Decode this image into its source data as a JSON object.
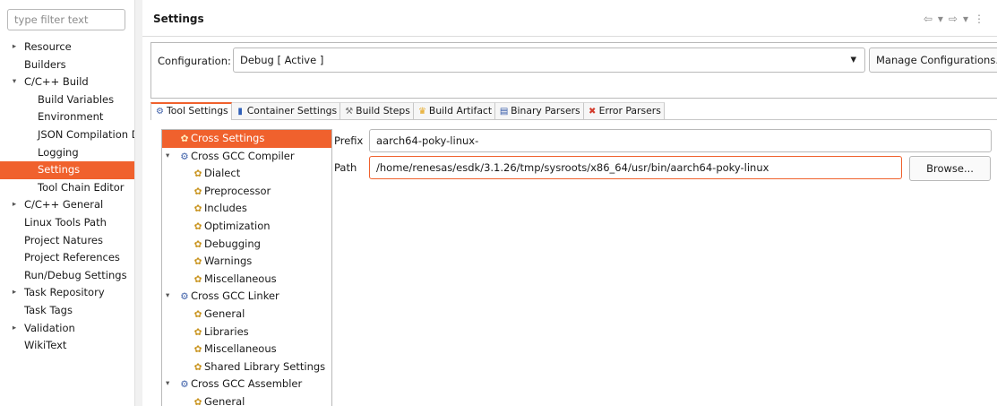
{
  "filter": {
    "placeholder": "type filter text"
  },
  "nav": {
    "items": [
      {
        "label": "Resource",
        "level": 0,
        "twisty": "▸"
      },
      {
        "label": "Builders",
        "level": 0,
        "twisty": ""
      },
      {
        "label": "C/C++ Build",
        "level": 0,
        "twisty": "▾"
      },
      {
        "label": "Build Variables",
        "level": 1,
        "twisty": ""
      },
      {
        "label": "Environment",
        "level": 1,
        "twisty": ""
      },
      {
        "label": "JSON Compilation D",
        "level": 1,
        "twisty": ""
      },
      {
        "label": "Logging",
        "level": 1,
        "twisty": ""
      },
      {
        "label": "Settings",
        "level": 1,
        "twisty": "",
        "selected": true
      },
      {
        "label": "Tool Chain Editor",
        "level": 1,
        "twisty": ""
      },
      {
        "label": "C/C++ General",
        "level": 0,
        "twisty": "▸"
      },
      {
        "label": "Linux Tools Path",
        "level": 0,
        "twisty": ""
      },
      {
        "label": "Project Natures",
        "level": 0,
        "twisty": ""
      },
      {
        "label": "Project References",
        "level": 0,
        "twisty": ""
      },
      {
        "label": "Run/Debug Settings",
        "level": 0,
        "twisty": ""
      },
      {
        "label": "Task Repository",
        "level": 0,
        "twisty": "▸"
      },
      {
        "label": "Task Tags",
        "level": 0,
        "twisty": ""
      },
      {
        "label": "Validation",
        "level": 0,
        "twisty": "▸"
      },
      {
        "label": "WikiText",
        "level": 0,
        "twisty": ""
      }
    ]
  },
  "header": {
    "title": "Settings",
    "nav_icons": {
      "back": "⇦",
      "back_menu": "▾",
      "forward": "⇨",
      "forward_menu": "▾",
      "more": "⋮"
    }
  },
  "config": {
    "label": "Configuration:",
    "selected": "Debug  [ Active ]",
    "manage_label": "Manage Configurations..."
  },
  "tabs": [
    {
      "label": "Tool Settings",
      "icon": "gear-icon",
      "glyph": "⚙",
      "cls": "gear",
      "active": true
    },
    {
      "label": "Container Settings",
      "icon": "container-icon",
      "glyph": "▮",
      "cls": "cyl"
    },
    {
      "label": "Build Steps",
      "icon": "hammer-icon",
      "glyph": "⚒",
      "cls": "ham"
    },
    {
      "label": "Build Artifact",
      "icon": "trophy-icon",
      "glyph": "♛",
      "cls": "trophy"
    },
    {
      "label": "Binary Parsers",
      "icon": "binary-icon",
      "glyph": "▤",
      "cls": "bin"
    },
    {
      "label": "Error Parsers",
      "icon": "error-icon",
      "glyph": "✖",
      "cls": "err"
    }
  ],
  "tool_tree": {
    "items": [
      {
        "label": "Cross Settings",
        "kind": "sec",
        "twisty": "",
        "icon": "settings-icon",
        "glyph": "✿",
        "icls": "opt-c",
        "selected": true
      },
      {
        "label": "Cross GCC Compiler",
        "kind": "sec",
        "twisty": "▾",
        "icon": "tool-icon",
        "glyph": "⚙",
        "icls": "gear-c"
      },
      {
        "label": "Dialect",
        "kind": "sub",
        "twisty": "",
        "icon": "option-icon",
        "glyph": "✿",
        "icls": "opt-c"
      },
      {
        "label": "Preprocessor",
        "kind": "sub",
        "twisty": "",
        "icon": "option-icon",
        "glyph": "✿",
        "icls": "opt-c"
      },
      {
        "label": "Includes",
        "kind": "sub",
        "twisty": "",
        "icon": "option-icon",
        "glyph": "✿",
        "icls": "opt-c"
      },
      {
        "label": "Optimization",
        "kind": "sub",
        "twisty": "",
        "icon": "option-icon",
        "glyph": "✿",
        "icls": "opt-c"
      },
      {
        "label": "Debugging",
        "kind": "sub",
        "twisty": "",
        "icon": "option-icon",
        "glyph": "✿",
        "icls": "opt-c"
      },
      {
        "label": "Warnings",
        "kind": "sub",
        "twisty": "",
        "icon": "option-icon",
        "glyph": "✿",
        "icls": "opt-c"
      },
      {
        "label": "Miscellaneous",
        "kind": "sub",
        "twisty": "",
        "icon": "option-icon",
        "glyph": "✿",
        "icls": "opt-c"
      },
      {
        "label": "Cross GCC Linker",
        "kind": "sec",
        "twisty": "▾",
        "icon": "tool-icon",
        "glyph": "⚙",
        "icls": "gear-c"
      },
      {
        "label": "General",
        "kind": "sub",
        "twisty": "",
        "icon": "option-icon",
        "glyph": "✿",
        "icls": "opt-c"
      },
      {
        "label": "Libraries",
        "kind": "sub",
        "twisty": "",
        "icon": "option-icon",
        "glyph": "✿",
        "icls": "opt-c"
      },
      {
        "label": "Miscellaneous",
        "kind": "sub",
        "twisty": "",
        "icon": "option-icon",
        "glyph": "✿",
        "icls": "opt-c"
      },
      {
        "label": "Shared Library Settings",
        "kind": "sub",
        "twisty": "",
        "icon": "option-icon",
        "glyph": "✿",
        "icls": "opt-c"
      },
      {
        "label": "Cross GCC Assembler",
        "kind": "sec",
        "twisty": "▾",
        "icon": "tool-icon",
        "glyph": "⚙",
        "icls": "gear-c"
      },
      {
        "label": "General",
        "kind": "sub",
        "twisty": "",
        "icon": "option-icon",
        "glyph": "✿",
        "icls": "opt-c"
      }
    ]
  },
  "fields": {
    "prefix_label": "Prefix",
    "prefix_value": "aarch64-poky-linux-",
    "path_label": "Path",
    "path_value": "/home/renesas/esdk/3.1.26/tmp/sysroots/x86_64/usr/bin/aarch64-poky-linux",
    "browse_label": "Browse..."
  },
  "colors": {
    "accent": "#f0612d",
    "border": "#b9b9b9"
  }
}
